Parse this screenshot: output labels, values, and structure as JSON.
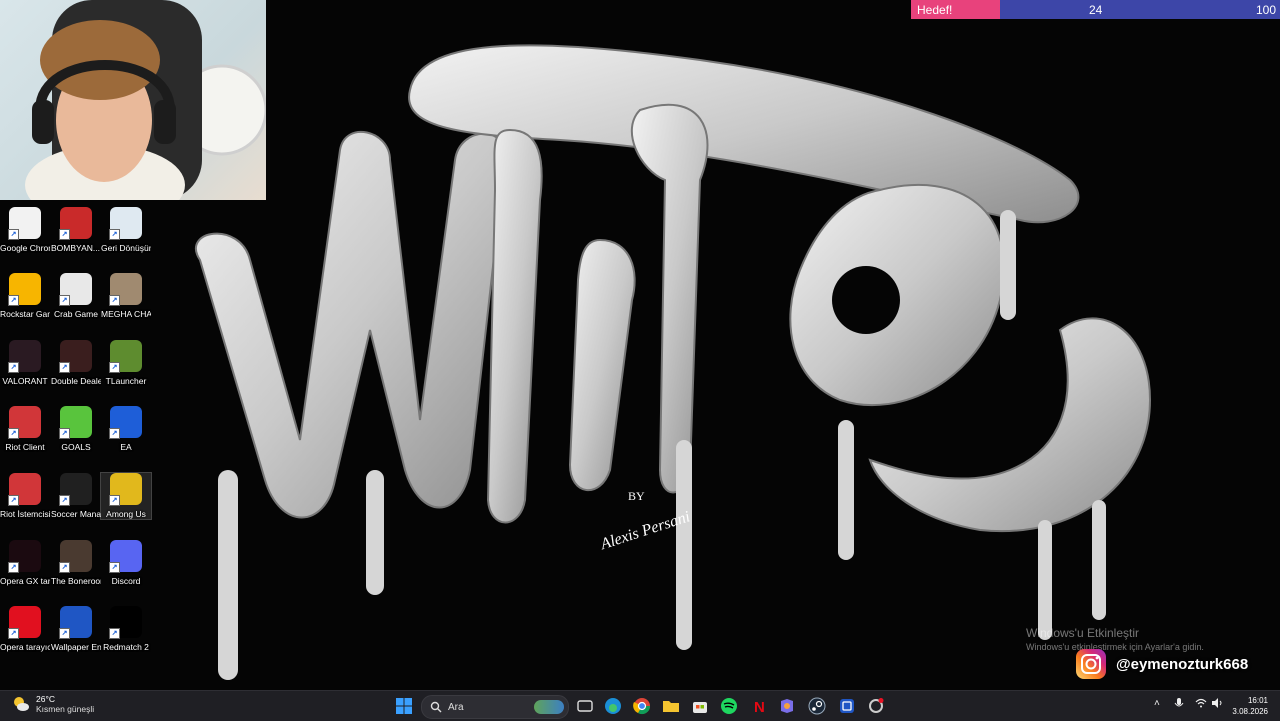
{
  "goal": {
    "label": "Hedef!",
    "current": "24",
    "target": "100",
    "progress": 0.24
  },
  "wallpaper": {
    "title": "WHITE",
    "credit_by": "BY",
    "credit_artist": "Alexis Persani"
  },
  "desktop_icons": [
    {
      "label": "Google Chrome",
      "icon": "chrome-icon",
      "color": "#f2f2f2"
    },
    {
      "label": "BOMBYAN... Demo",
      "icon": "game-icon",
      "color": "#c92a2a"
    },
    {
      "label": "Geri Dönüşüm...",
      "icon": "recycle-bin-icon",
      "color": "#dfe9f1"
    },
    {
      "label": "Rockstar Games ...",
      "icon": "rockstar-icon",
      "color": "#f7b500"
    },
    {
      "label": "Crab Game",
      "icon": "crab-game-icon",
      "color": "#e8e8e8"
    },
    {
      "label": "MEGHA CHAMELEON",
      "icon": "game-icon",
      "color": "#a08a70"
    },
    {
      "label": "VALORANT",
      "icon": "valorant-icon",
      "color": "#2a1a22"
    },
    {
      "label": "Double Deale...",
      "icon": "double-dealer-icon",
      "color": "#3a1e1e"
    },
    {
      "label": "TLauncher",
      "icon": "minecraft-icon",
      "color": "#5e8c2f"
    },
    {
      "label": "Riot Client",
      "icon": "riot-icon",
      "color": "#d13639"
    },
    {
      "label": "GOALS",
      "icon": "goals-icon",
      "color": "#59c43d"
    },
    {
      "label": "EA",
      "icon": "ea-icon",
      "color": "#1e5ed8"
    },
    {
      "label": "Riot İstemcisi",
      "icon": "riot-icon",
      "color": "#d13639"
    },
    {
      "label": "Soccer Manag...",
      "icon": "sm26-icon",
      "color": "#202020"
    },
    {
      "label": "Among Us",
      "icon": "among-us-icon",
      "color": "#e1b81c"
    },
    {
      "label": "Opera GX tarayıcı",
      "icon": "opera-gx-icon",
      "color": "#1b0a10"
    },
    {
      "label": "The Bonerooms",
      "icon": "bonerooms-icon",
      "color": "#4a3a30"
    },
    {
      "label": "Discord",
      "icon": "discord-icon",
      "color": "#5865f2"
    },
    {
      "label": "Opera tarayıcı",
      "icon": "opera-icon",
      "color": "#e1101f"
    },
    {
      "label": "Wallpaper Engine",
      "icon": "wallpaper-engine-icon",
      "color": "#1f56c4"
    },
    {
      "label": "Redmatch 2",
      "icon": "redmatch-icon",
      "color": "#000000"
    }
  ],
  "activation": {
    "line1": "Windows'u Etkinleştir",
    "line2": "Windows'u etkinleştirmek için Ayarlar'a gidin."
  },
  "instagram": {
    "handle": "@eymenozturk668"
  },
  "taskbar": {
    "weather": {
      "temp": "26°C",
      "condition": "Kısmen güneşli"
    },
    "search_placeholder": "Ara",
    "clock": {
      "time": "16:01",
      "date": "3.08.2026"
    }
  },
  "colors": {
    "goal_fill": "#e8427c",
    "goal_bg": "#3d46a8",
    "taskbar": "#1f1f24"
  }
}
